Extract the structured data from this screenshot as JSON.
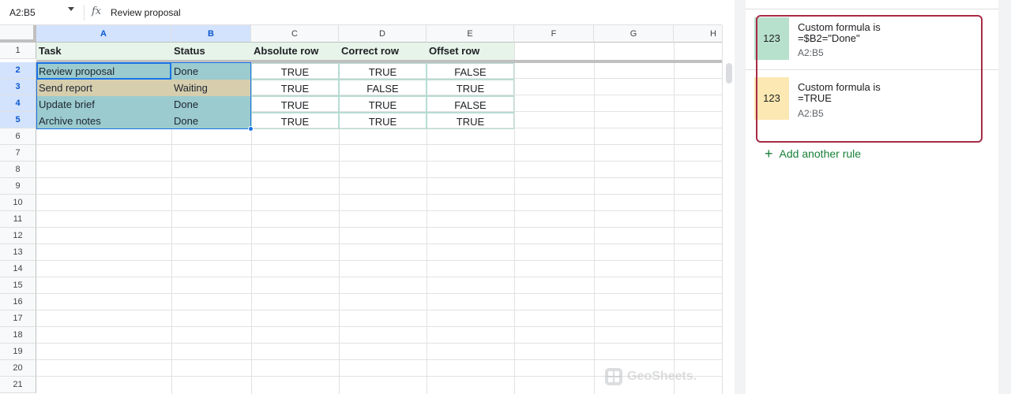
{
  "formula_bar": {
    "name_box": "A2:B5",
    "fx_icon": "fx",
    "formula": "Review proposal"
  },
  "columns": [
    "A",
    "B",
    "C",
    "D",
    "E",
    "F",
    "G",
    "H"
  ],
  "rows": [
    "1",
    "2",
    "3",
    "4",
    "5",
    "6",
    "7",
    "8",
    "9",
    "10",
    "11",
    "12",
    "13",
    "14",
    "15",
    "16",
    "17",
    "18",
    "19",
    "20",
    "21"
  ],
  "table": {
    "headers": [
      "Task",
      "Status",
      "Absolute row",
      "Correct row",
      "Offset row"
    ],
    "rows": [
      [
        "Review proposal",
        "Done",
        "TRUE",
        "TRUE",
        "FALSE"
      ],
      [
        "Send report",
        "Waiting",
        "TRUE",
        "FALSE",
        "TRUE"
      ],
      [
        "Update brief",
        "Done",
        "TRUE",
        "TRUE",
        "FALSE"
      ],
      [
        "Archive notes",
        "Done",
        "TRUE",
        "TRUE",
        "TRUE"
      ]
    ]
  },
  "colors": {
    "done_fill": "#a6d3cc",
    "waiting_fill": "#e7d6a9",
    "header_fill": "#e6f4ea",
    "selection": "#1a73e8",
    "rule_outline": "#a72b46"
  },
  "panel": {
    "rules": [
      {
        "preview": "123",
        "title_line1": "Custom formula is",
        "title_line2": "=$B2=\"Done\"",
        "range": "A2:B5",
        "swatch_color": "#b7e1cd"
      },
      {
        "preview": "123",
        "title_line1": "Custom formula is",
        "title_line2": "=TRUE",
        "range": "A2:B5",
        "swatch_color": "#fce8b2"
      }
    ],
    "add_rule_icon": "+",
    "add_rule_label": "Add another rule"
  },
  "watermark": "GeoSheets."
}
